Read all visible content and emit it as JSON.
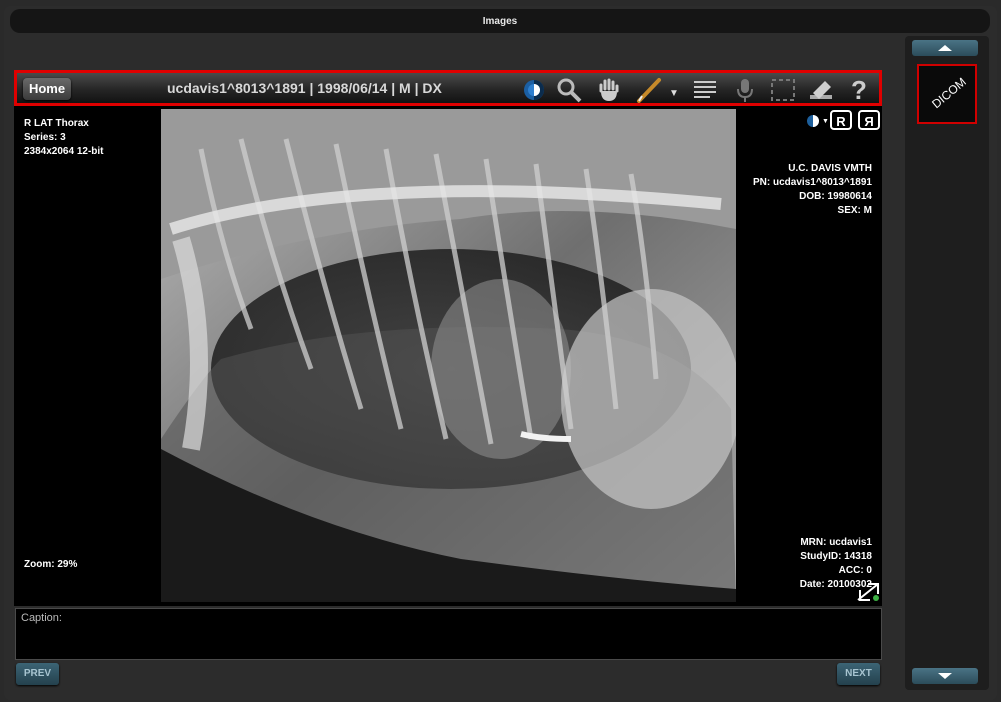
{
  "window": {
    "title": "Images"
  },
  "toolbar": {
    "home_label": "Home",
    "study_title": "ucdavis1^8013^1891 | 1998/06/14 | M | DX",
    "tools": [
      "contrast-icon",
      "magnifier-icon",
      "pan-hand-icon",
      "annotate-pen-icon",
      "dropdown-arrow-icon",
      "text-lines-icon",
      "microphone-icon",
      "fit-frame-icon",
      "clear-annotations-icon",
      "help-icon"
    ]
  },
  "overlay": {
    "top_left": [
      "R LAT Thorax",
      "Series: 3",
      "2384x2064 12-bit"
    ],
    "zoom": "Zoom: 29%",
    "top_right": [
      "U.C. DAVIS VMTH",
      "PN: ucdavis1^8013^1891",
      "DOB: 19980614",
      "SEX: M"
    ],
    "bottom_right": [
      "MRN: ucdavis1",
      "StudyID: 14318",
      "ACC: 0",
      "Date: 20100302"
    ],
    "flip_h": "R",
    "flip_v": "R"
  },
  "caption": {
    "label": "Caption:"
  },
  "nav": {
    "prev": "PREV",
    "next": "NEXT"
  },
  "thumbnail": {
    "label": "DICOM"
  },
  "colors": {
    "highlight": "#e00000",
    "accent_btn": "#2f5563"
  }
}
